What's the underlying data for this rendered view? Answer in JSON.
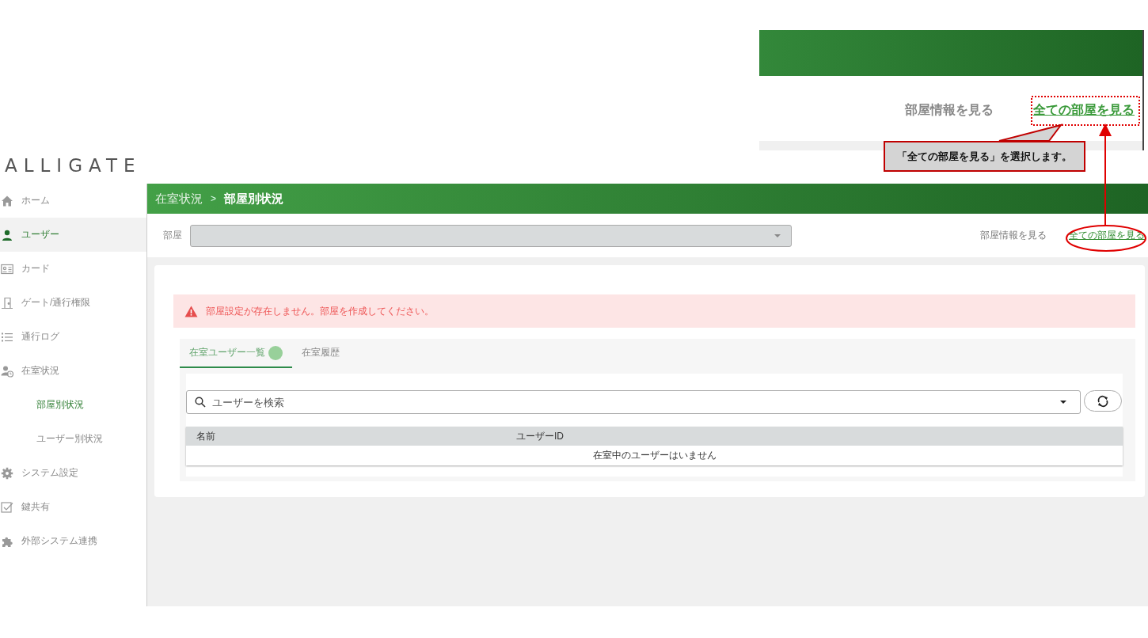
{
  "logo": "ALLIGATE",
  "inset": {
    "links": [
      {
        "label": "部屋情報を見る",
        "kind": "plain"
      },
      {
        "label": "全ての部屋を見る",
        "kind": "link"
      }
    ]
  },
  "callout": "「全ての部屋を見る」を選択します。",
  "sidebar": {
    "items": [
      {
        "label": "ホーム",
        "selected": false
      },
      {
        "label": "ユーザー",
        "selected": true
      },
      {
        "label": "カード",
        "selected": false
      },
      {
        "label": "ゲート/通行権限",
        "selected": false
      },
      {
        "label": "通行ログ",
        "selected": false
      },
      {
        "label": "在室状況",
        "selected": false,
        "children": [
          {
            "label": "部屋別状況",
            "selected": true
          },
          {
            "label": "ユーザー別状況",
            "selected": false
          }
        ]
      },
      {
        "label": "システム設定",
        "selected": false
      },
      {
        "label": "鍵共有",
        "selected": false
      },
      {
        "label": "外部システム連携",
        "selected": false
      }
    ]
  },
  "breadcrumb": {
    "parent": "在室状況",
    "separator": ">",
    "current": "部屋別状況"
  },
  "room_filter": {
    "label": "部屋",
    "disabled": true
  },
  "toolbar_links": [
    {
      "label": "部屋情報を見る",
      "kind": "plain"
    },
    {
      "label": "全ての部屋を見る",
      "kind": "link"
    }
  ],
  "alert": "部屋設定が存在しません。部屋を作成してください。",
  "tabs": [
    {
      "label": "在室ユーザー一覧",
      "selected": true,
      "badge": true
    },
    {
      "label": "在室履歴",
      "selected": false,
      "badge": false
    }
  ],
  "search": {
    "placeholder": "ユーザーを検索"
  },
  "table": {
    "columns": [
      "名前",
      "ユーザーID"
    ],
    "empty_message": "在室中のユーザーはいません"
  }
}
